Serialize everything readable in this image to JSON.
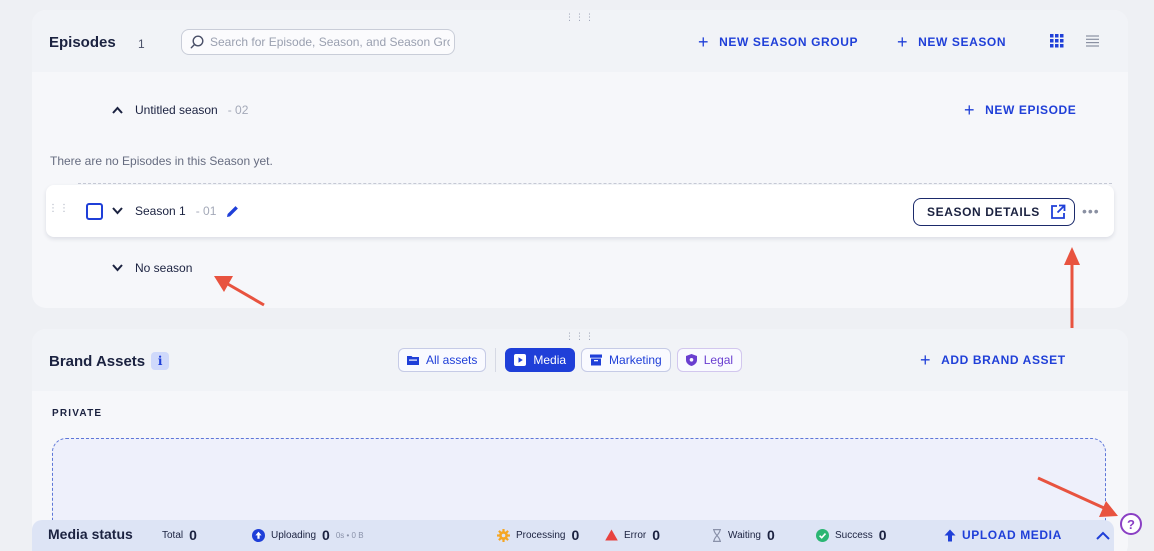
{
  "episodes": {
    "title": "Episodes",
    "count": "1",
    "search_placeholder": "Search for Episode, Season, and Season Group",
    "new_season_group_label": "NEW SEASON GROUP",
    "new_season_label": "NEW SEASON",
    "new_episode_label": "NEW EPISODE",
    "empty_message": "There are no Episodes in this Season yet.",
    "season_groups": [
      {
        "name": "Untitled season",
        "number": "- 02"
      }
    ],
    "seasons": [
      {
        "name": "Season 1",
        "number": "- 01",
        "details_label": "SEASON DETAILS"
      }
    ],
    "no_season_label": "No season"
  },
  "brand_assets": {
    "title": "Brand Assets",
    "info_icon": "i",
    "filters": [
      {
        "label": "All assets",
        "icon": "folder-icon",
        "active": false
      },
      {
        "label": "Media",
        "icon": "media-icon",
        "active": true
      },
      {
        "label": "Marketing",
        "icon": "archive-icon",
        "active": false
      },
      {
        "label": "Legal",
        "icon": "shield-icon",
        "active": false
      }
    ],
    "add_label": "ADD BRAND ASSET",
    "private_label": "PRIVATE"
  },
  "media_status": {
    "title": "Media status",
    "total_label": "Total",
    "total_value": "0",
    "uploading_label": "Uploading",
    "uploading_value": "0",
    "uploading_sub": "0s • 0 B",
    "processing_label": "Processing",
    "processing_value": "0",
    "error_label": "Error",
    "error_value": "0",
    "waiting_label": "Waiting",
    "waiting_value": "0",
    "success_label": "Success",
    "success_value": "0",
    "upload_label": "UPLOAD MEDIA"
  },
  "help": {
    "icon": "?"
  },
  "colors": {
    "accent": "#1f3fd8",
    "annotation_arrow": "#e8533f",
    "processing": "#f5a623",
    "error": "#e8423f",
    "success": "#2bb673",
    "help": "#8a3fc4"
  }
}
